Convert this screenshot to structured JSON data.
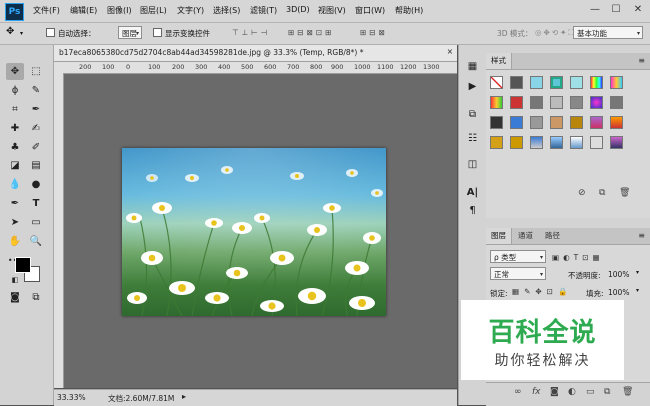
{
  "app": {
    "logo": "Ps"
  },
  "menu": [
    "文件(F)",
    "编辑(E)",
    "图像(I)",
    "图层(L)",
    "文字(Y)",
    "选择(S)",
    "滤镜(T)",
    "3D(D)",
    "视图(V)",
    "窗口(W)",
    "帮助(H)"
  ],
  "window_controls": {
    "minimize": "—",
    "maximize": "☐",
    "close": "✕"
  },
  "options": {
    "auto_select_label": "自动选择：",
    "auto_select_value": "图层",
    "show_transform_label": "显示变换控件",
    "mode_3d_label": "3D 模式：",
    "workspace_value": "基本功能"
  },
  "document": {
    "tab_title": "b17eca8065380cd75d2704c8ab44ad34598281de.jpg @ 33.3% (Temp, RGB/8*) *",
    "close": "×",
    "zoom": "33.33%",
    "doc_info": "文档:2.60M/7.81M"
  },
  "ruler": {
    "ticks": [
      "200",
      "100",
      "0",
      "100",
      "200",
      "300",
      "400",
      "500",
      "600",
      "700",
      "800",
      "900",
      "1000",
      "1100",
      "1200",
      "1300"
    ]
  },
  "panels": {
    "styles_tab": "样式",
    "layers_tabs": [
      "图层",
      "通道",
      "路径"
    ],
    "filter_kind": "ρ 类型",
    "blend_mode": "正常",
    "opacity_label": "不透明度:",
    "opacity_value": "100%",
    "lock_label": "锁定:",
    "fill_label": "填充:",
    "fill_value": "100%"
  },
  "watermark": {
    "title": "百科全说",
    "subtitle": "助你轻松解决"
  },
  "colors": {
    "foreground": "#000000",
    "background": "#ffffff",
    "accent": "#31a8ff",
    "watermark_green": "#2eaa50"
  }
}
